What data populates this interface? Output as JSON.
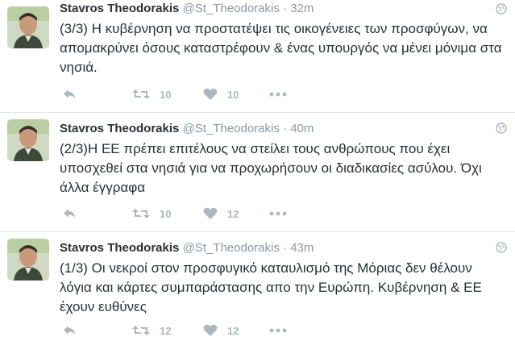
{
  "tweets": [
    {
      "name": "Stavros Theodorakis",
      "handle": "@St_Theodorakis",
      "separator": "·",
      "time": "32m",
      "text": "(3/3) Η κυβέρνηση να προστατέψει τις οικογένειες των προσφύγων, να απομακρύνει όσους καταστρέφουν & ένας υπουργός να μένει μόνιμα στα νησιά.",
      "retweets": "10",
      "likes": "10"
    },
    {
      "name": "Stavros Theodorakis",
      "handle": "@St_Theodorakis",
      "separator": "·",
      "time": "40m",
      "text": "(2/3)Η ΕΕ πρέπει επιτέλους να στείλει τους ανθρώπους που έχει υποσχεθεί στα νησιά για να προχωρήσουν οι διαδικασίες ασύλου. Όχι άλλα έγγραφα",
      "retweets": "10",
      "likes": "12"
    },
    {
      "name": "Stavros Theodorakis",
      "handle": "@St_Theodorakis",
      "separator": "·",
      "time": "43m",
      "text": "(1/3) Οι νεκροί στον προσφυγικό καταυλισμό της Μόριας δεν θέλουν λόγια και κάρτες συμπαράστασης απο την Ευρώπη. Κυβέρνηση & ΕΕ έχουν ευθύνες",
      "retweets": "12",
      "likes": "12"
    }
  ],
  "icons": {
    "reply": "reply-icon",
    "retweet": "retweet-icon",
    "like": "heart-icon",
    "more": "more-icon",
    "globe": "globe-icon",
    "avatar": "avatar"
  },
  "colors": {
    "text": "#292f33",
    "muted": "#8899a6",
    "action": "#aab8c2",
    "divider": "#e1e8ed"
  }
}
